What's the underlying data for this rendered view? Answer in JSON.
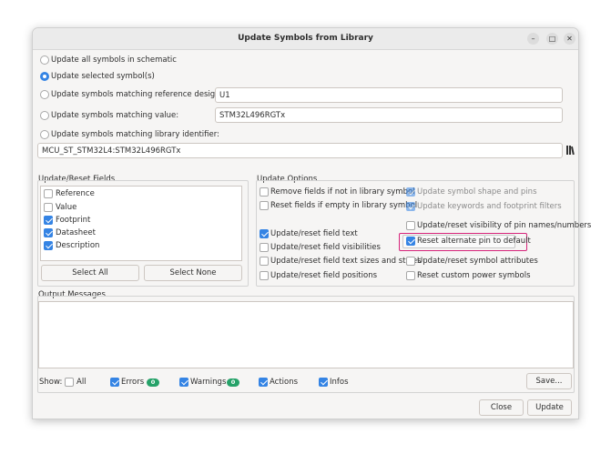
{
  "window": {
    "title": "Update Symbols from Library",
    "minimize": "–",
    "maximize": "□",
    "close": "✕"
  },
  "scope": {
    "options": [
      {
        "label": "Update all symbols in schematic",
        "checked": false
      },
      {
        "label": "Update selected symbol(s)",
        "checked": true
      },
      {
        "label": "Update symbols matching reference designator:",
        "checked": false
      },
      {
        "label": "Update symbols matching value:",
        "checked": false
      },
      {
        "label": "Update symbols matching library identifier:",
        "checked": false
      }
    ],
    "ref_designator_value": "U1",
    "value_value": "STM32L496RGTx",
    "lib_id_value": "MCU_ST_STM32L4:STM32L496RGTx"
  },
  "fields": {
    "title": "Update/Reset Fields",
    "items": [
      {
        "label": "Reference",
        "checked": false
      },
      {
        "label": "Value",
        "checked": false
      },
      {
        "label": "Footprint",
        "checked": true
      },
      {
        "label": "Datasheet",
        "checked": true
      },
      {
        "label": "Description",
        "checked": true
      }
    ],
    "select_all": "Select All",
    "select_none": "Select None"
  },
  "update_options": {
    "title": "Update Options",
    "left": [
      {
        "label": "Remove fields if not in library symbol",
        "checked": false
      },
      {
        "label": "Reset fields if empty in library symbol",
        "checked": false
      },
      {
        "label": "Update/reset field text",
        "checked": true
      },
      {
        "label": "Update/reset field visibilities",
        "checked": false
      },
      {
        "label": "Update/reset field text sizes and styles",
        "checked": false
      },
      {
        "label": "Update/reset field positions",
        "checked": false
      }
    ],
    "right": [
      {
        "label": "Update symbol shape and pins",
        "checked": true,
        "disabled": true
      },
      {
        "label": "Update keywords and footprint filters",
        "checked": true,
        "disabled": true
      },
      {
        "label": "Update/reset visibility of pin names/numbers",
        "checked": false
      },
      {
        "label": "Reset alternate pin to default",
        "checked": true
      },
      {
        "label": "Update/reset symbol attributes",
        "checked": false
      },
      {
        "label": "Reset custom power symbols",
        "checked": false
      }
    ]
  },
  "output": {
    "title": "Output Messages",
    "show_label": "Show:",
    "filters": [
      {
        "label": "All",
        "checked": false
      },
      {
        "label": "Errors",
        "checked": true,
        "count": "0"
      },
      {
        "label": "Warnings",
        "checked": true,
        "count": "0"
      },
      {
        "label": "Actions",
        "checked": true
      },
      {
        "label": "Infos",
        "checked": true
      }
    ],
    "save": "Save..."
  },
  "footer": {
    "close": "Close",
    "update": "Update"
  },
  "colors": {
    "accent": "#3584e4",
    "badge": "#26a269",
    "highlight": "#d6237a"
  }
}
